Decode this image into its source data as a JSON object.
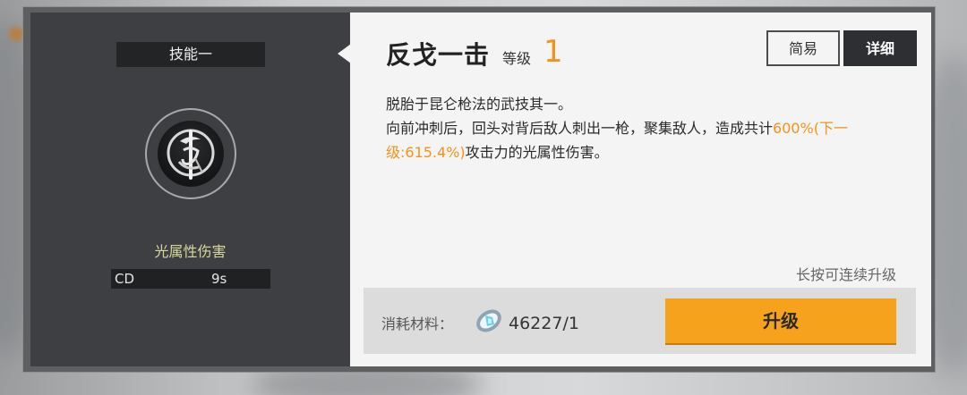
{
  "skill_panel": {
    "tag": "技能一",
    "icon": "spear-emblem-icon",
    "attribute": "光属性伤害",
    "cd_label": "CD",
    "cd_value": "9s"
  },
  "detail": {
    "title": "反戈一击",
    "level_label": "等级",
    "level_value": "1",
    "tabs": [
      {
        "label": "简易",
        "active": false
      },
      {
        "label": "详细",
        "active": true
      }
    ],
    "desc_line1": "脱胎于昆仑枪法的武技其一。",
    "desc_line2_pre": "向前冲刺后，回头对背后敌人刺出一枪，聚集敌人，造成共计",
    "desc_highlight": "600%(下一级:615.4%)",
    "desc_line2_post": "攻击力的光属性伤害。",
    "hint": "长按可连续升级"
  },
  "cost": {
    "label": "消耗材料：",
    "material_icon": "crystal-material-icon",
    "amount": "46227/1",
    "upgrade_label": "升级"
  },
  "colors": {
    "accent": "#f2931a",
    "button": "#f7a21c",
    "attribute": "#d9d79a",
    "dark_panel": "#3d3f42",
    "light_panel": "#f4f4f4"
  }
}
